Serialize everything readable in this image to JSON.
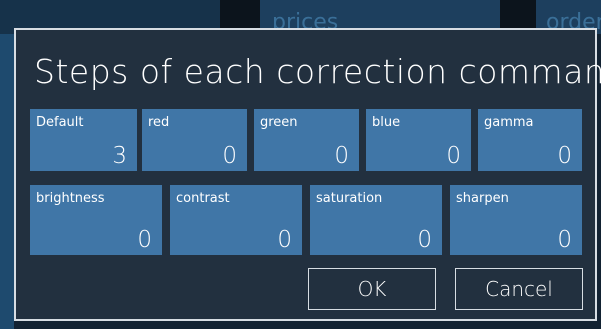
{
  "background": {
    "labels": [
      "prices",
      "order"
    ]
  },
  "dialog": {
    "title": "Steps of each correction command",
    "row1": [
      {
        "name": "Default",
        "value": "3"
      },
      {
        "name": "red",
        "value": "0"
      },
      {
        "name": "green",
        "value": "0"
      },
      {
        "name": "blue",
        "value": "0"
      },
      {
        "name": "gamma",
        "value": "0"
      }
    ],
    "row2": [
      {
        "name": "brightness",
        "value": "0"
      },
      {
        "name": "contrast",
        "value": "0"
      },
      {
        "name": "saturation",
        "value": "0"
      },
      {
        "name": "sharpen",
        "value": "0"
      }
    ],
    "ok_label": "OK",
    "cancel_label": "Cancel"
  },
  "colors": {
    "dialog_bg": "#22303f",
    "tile_bg": "#4076a7",
    "border": "#d7dde3",
    "text": "#ffffff"
  }
}
